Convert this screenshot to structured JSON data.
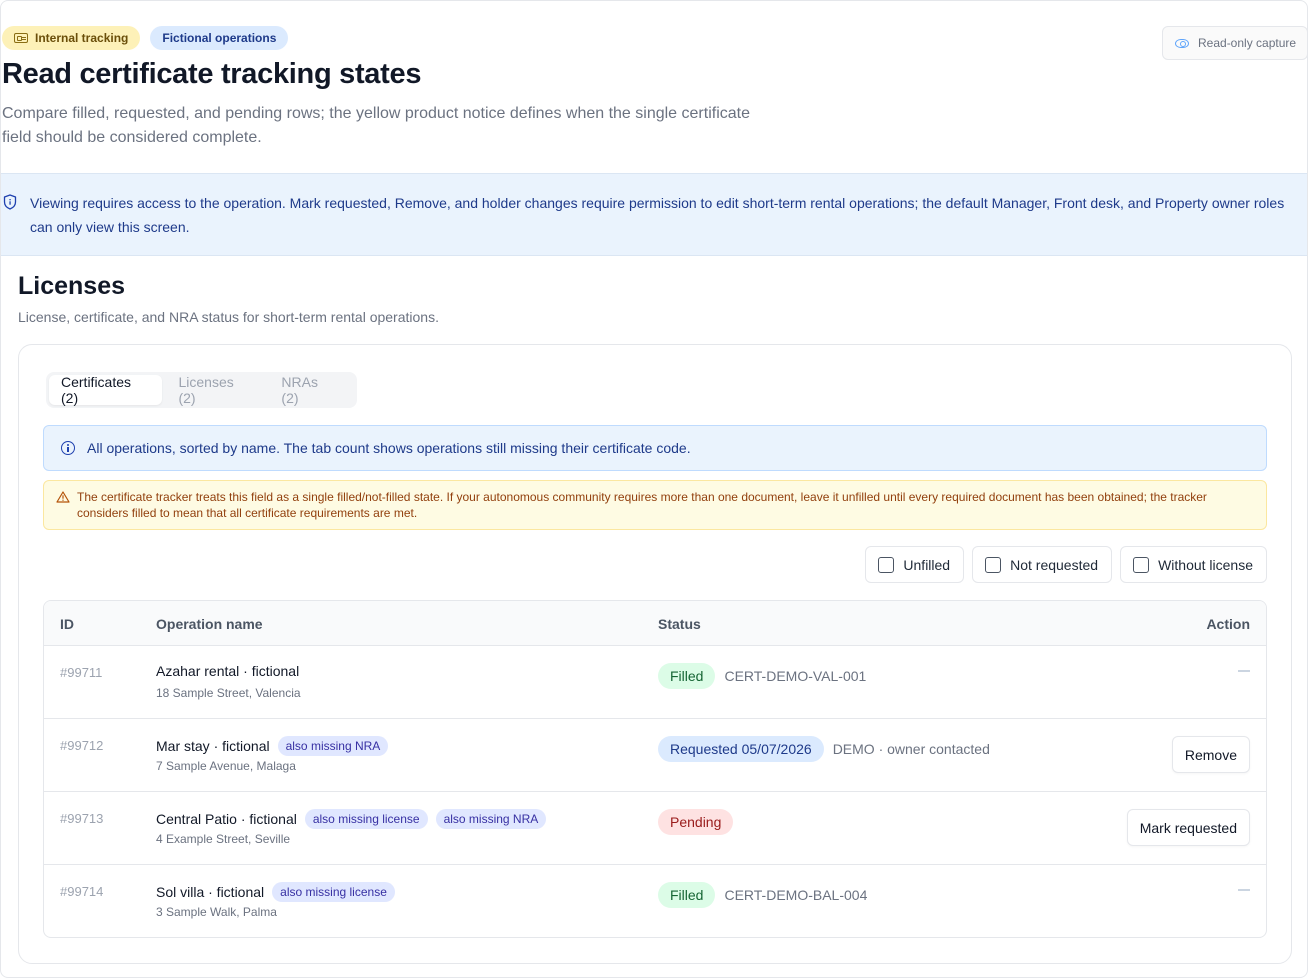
{
  "header": {
    "pills": [
      {
        "label": "Internal tracking",
        "icon": "id-card-icon",
        "color": "#fdf1b8"
      },
      {
        "label": "Fictional operations",
        "color": "#dbeafe"
      }
    ],
    "capture_label": "Read-only capture",
    "title": "Read certificate tracking states",
    "subtitle": "Compare filled, requested, and pending rows; the yellow product notice defines when the single certificate field should be considered complete."
  },
  "access_notice": "Viewing requires access to the operation. Mark requested, Remove, and holder changes require permission to edit short-term rental operations; the default Manager, Front desk, and Property owner roles can only view this screen.",
  "section": {
    "title": "Licenses",
    "description": "License, certificate, and NRA status for short-term rental operations."
  },
  "tabs": [
    {
      "label": "Certificates (2)",
      "active": true
    },
    {
      "label": "Licenses (2)",
      "active": false
    },
    {
      "label": "NRAs (2)",
      "active": false
    }
  ],
  "info_notice": "All operations, sorted by name. The tab count shows operations still missing their certificate code.",
  "warning_notice": "The certificate tracker treats this field as a single filled/not-filled state. If your autonomous community requires more than one document, leave it unfilled until every required document has been obtained; the tracker considers filled to mean that all certificate requirements are met.",
  "filters": [
    {
      "label": "Unfilled",
      "checked": false
    },
    {
      "label": "Not requested",
      "checked": false
    },
    {
      "label": "Without license",
      "checked": false
    }
  ],
  "table": {
    "columns": {
      "id": "ID",
      "name": "Operation name",
      "status": "Status",
      "action": "Action"
    },
    "rows": [
      {
        "id": "#99711",
        "name": "Azahar rental · fictional",
        "tags": [],
        "address": "18 Sample Street, Valencia",
        "status": "Filled",
        "status_kind": "filled",
        "detail": "CERT-DEMO-VAL-001",
        "action": ""
      },
      {
        "id": "#99712",
        "name": "Mar stay · fictional",
        "tags": [
          "also missing NRA"
        ],
        "address": "7 Sample Avenue, Malaga",
        "status": "Requested 05/07/2026",
        "status_kind": "requested",
        "detail": "DEMO · owner contacted",
        "action": "Remove"
      },
      {
        "id": "#99713",
        "name": "Central Patio · fictional",
        "tags": [
          "also missing license",
          "also missing NRA"
        ],
        "address": "4 Example Street, Seville",
        "status": "Pending",
        "status_kind": "pending",
        "detail": "",
        "action": "Mark requested"
      },
      {
        "id": "#99714",
        "name": "Sol villa · fictional",
        "tags": [
          "also missing license"
        ],
        "address": "3 Sample Walk, Palma",
        "status": "Filled",
        "status_kind": "filled",
        "detail": "CERT-DEMO-BAL-004",
        "action": ""
      }
    ]
  }
}
